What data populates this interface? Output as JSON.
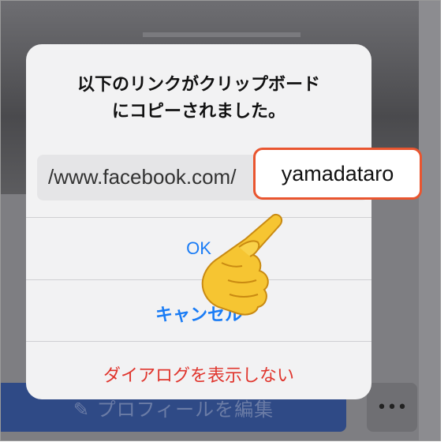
{
  "background": {
    "edit_profile_label": "✎ プロフィールを編集",
    "more_label": "•••"
  },
  "alert": {
    "message_line1": "以下のリンクがクリップボード",
    "message_line2": "にコピーされました。",
    "url_text": "/www.facebook.com/",
    "ok_label": "OK",
    "cancel_label": "キャンセル",
    "dont_show_label": "ダイアログを表示しない"
  },
  "highlight": {
    "username": "yamadataro"
  },
  "colors": {
    "ios_blue": "#1a7cf5",
    "destructive_red": "#e0352d",
    "highlight_border": "#e9552f"
  },
  "icons": {
    "pointing_hand": "pointing-hand-icon"
  }
}
